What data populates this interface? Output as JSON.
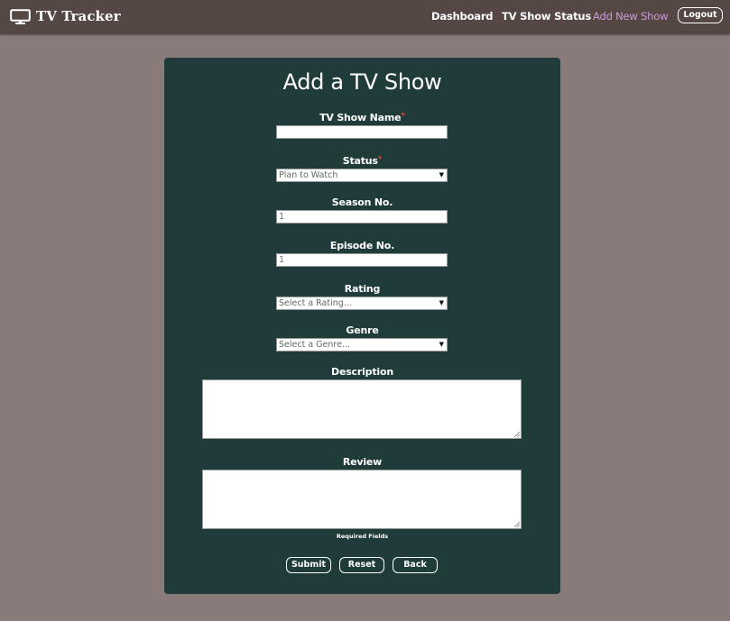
{
  "navbar": {
    "brand": "TV Tracker",
    "brand_icon": "tv-icon",
    "links": [
      "Dashboard",
      "TV Show Status",
      "Add New Show"
    ],
    "active_link": "Add New Show",
    "active_color": "#c99bd6",
    "logout_label": "Logout"
  },
  "form": {
    "title": "Add a TV Show",
    "required_marker": "*",
    "show_name": {
      "label": "TV Show Name",
      "value": ""
    },
    "status": {
      "label": "Status",
      "selected": "Plan to Watch"
    },
    "season": {
      "label": "Season No.",
      "value": "1"
    },
    "episode": {
      "label": "Episode No.",
      "value": "1"
    },
    "rating": {
      "label": "Rating",
      "selected": "Select a Rating..."
    },
    "genre": {
      "label": "Genre",
      "selected": "Select a Genre..."
    },
    "description": {
      "label": "Description",
      "value": ""
    },
    "review": {
      "label": "Review",
      "value": ""
    },
    "required_note": "Required Fields",
    "buttons": {
      "submit": "Submit",
      "reset": "Reset",
      "back": "Back"
    }
  },
  "colors": {
    "page_bg": "#8a7b7b",
    "navbar_bg": "#554744",
    "card_bg": "#1f3b3a",
    "required": "#e0463f"
  }
}
